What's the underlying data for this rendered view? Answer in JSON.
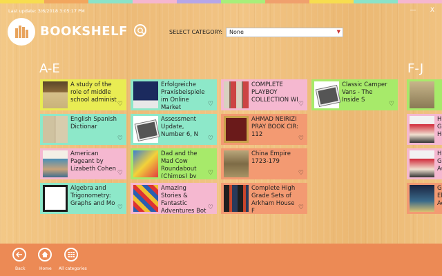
{
  "window": {
    "last_update": "Last update: 3/6/2018 3:05:17 PM",
    "minimize": "—",
    "close": "X",
    "stripe_colors": [
      "#f7dd4f",
      "#f2a65e",
      "#8be3c8",
      "#f6b6cf",
      "#b5a6e8",
      "#a7ef7a",
      "#f0a06d",
      "#f7dd4f",
      "#8be3c8",
      "#f6b6cf"
    ]
  },
  "header": {
    "app_title": "BOOKSHELF",
    "category_label": "SELECT CATEGORY:",
    "category_value": "None"
  },
  "sections": [
    {
      "label": "A-E"
    },
    {
      "label": "F-J"
    }
  ],
  "books": [
    {
      "title": "A study of the role of middle school administ",
      "color": "#e9ec53",
      "thumb": "book-cover-antique"
    },
    {
      "title": "English Spanish Dictionar",
      "color": "#8de8c9",
      "thumb": "book-cover-dictionary"
    },
    {
      "title": "American Pageant by Lizabeth Cohen",
      "color": "#f5b8d0",
      "thumb": "book-cover-pageant"
    },
    {
      "title": "Algebra and Trigonometry: Graphs and Mo",
      "color": "#8de8c9",
      "thumb": "book-cover-algebra"
    },
    {
      "title": "Erfolgreiche Praxisbeispiele im Online Market",
      "color": "#8de8c9",
      "thumb": "book-cover-marketing"
    },
    {
      "title": "Assessment Update, Number 6, N",
      "color": "#8de8c9",
      "thumb": "placeholder-image-icon"
    },
    {
      "title": "Dad and the Mad Cow Roundabout (Chimps) by Moo",
      "color": "#a7ea6a",
      "thumb": "book-cover-comic"
    },
    {
      "title": "Amazing Stories & Fantastic Adventures Bot",
      "color": "#f5b8d0",
      "thumb": "book-cover-amazing-stories"
    },
    {
      "title": "COMPLETE PLAYBOY COLLECTION WI",
      "color": "#f5b8d0",
      "thumb": "book-cover-magazines"
    },
    {
      "title": "AHMAD NEIRIZI PRAY BOOK CIR: 112",
      "color": "#f39a72",
      "thumb": "book-cover-persian"
    },
    {
      "title": "China Empire 1723-179",
      "color": "#f39a72",
      "thumb": "book-cover-china-scroll"
    },
    {
      "title": "Complete High Grade Sets of Arkham House F",
      "color": "#f39a72",
      "thumb": "book-cover-arkham"
    },
    {
      "title": "Classic Camper Vans - The Inside S",
      "color": "#a7ea6a",
      "thumb": "placeholder-image-icon"
    }
  ],
  "right_books": [
    {
      "title": "",
      "color": "#a7ea6a",
      "thumb": "book-cover-partial"
    },
    {
      "title": "Hig Gra He",
      "color": "#f5b8d0",
      "thumb": "book-cover-playboy"
    },
    {
      "title": "Hig Gra Au",
      "color": "#f5b8d0",
      "thumb": "book-cover-playboy"
    },
    {
      "title": "G- Ele Ae",
      "color": "#f39a72",
      "thumb": "book-cover-scifi"
    }
  ],
  "nav": {
    "back": "Back",
    "home": "Home",
    "all": "All categories"
  }
}
